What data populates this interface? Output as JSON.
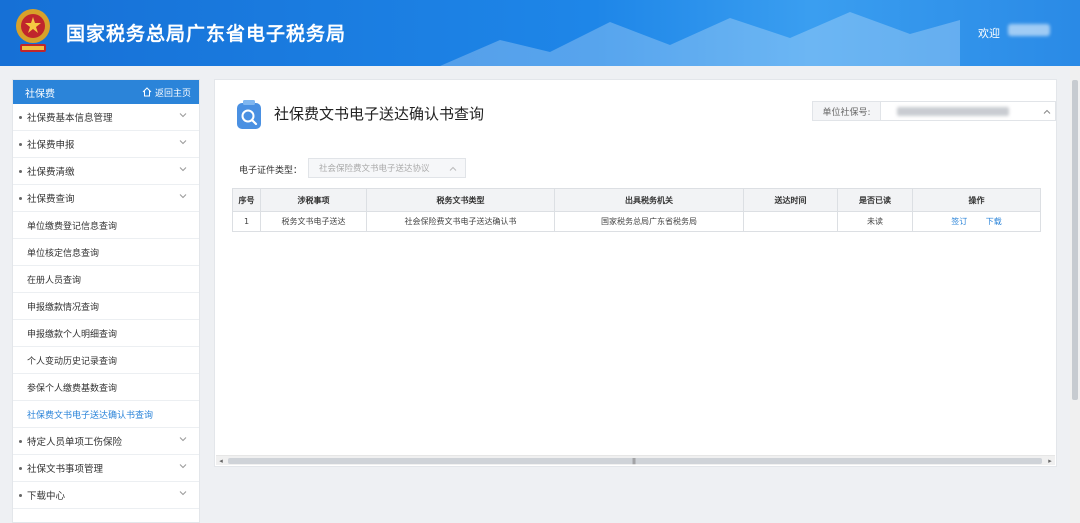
{
  "header": {
    "title": "国家税务总局广东省电子税务局",
    "welcome": "欢迎"
  },
  "sidebar": {
    "title": "社保费",
    "home_link": "返回主页",
    "items": [
      {
        "label": "社保费基本信息管理"
      },
      {
        "label": "社保费申报"
      },
      {
        "label": "社保费清缴"
      },
      {
        "label": "社保费查询"
      }
    ],
    "sub_items": [
      {
        "label": "单位缴费登记信息查询"
      },
      {
        "label": "单位核定信息查询"
      },
      {
        "label": "在册人员查询"
      },
      {
        "label": "申报缴款情况查询"
      },
      {
        "label": "申报缴款个人明细查询"
      },
      {
        "label": "个人变动历史记录查询"
      },
      {
        "label": "参保个人缴费基数查询"
      },
      {
        "label": "社保费文书电子送达确认书查询"
      }
    ],
    "items_after": [
      {
        "label": "特定人员单项工伤保险"
      },
      {
        "label": "社保文书事项管理"
      },
      {
        "label": "下载中心"
      }
    ]
  },
  "main": {
    "page_title": "社保费文书电子送达确认书查询",
    "unit_label": "单位社保号:",
    "filter_label": "电子证件类型：",
    "filter_value": "社会保险费文书电子送达协议",
    "table": {
      "headers": [
        "序号",
        "涉税事项",
        "税务文书类型",
        "出具税务机关",
        "送达时间",
        "是否已读",
        "操作"
      ],
      "rows": [
        [
          "1",
          "税务文书电子送达",
          "社会保险费文书电子送达确认书",
          "国家税务总局广东省税务局",
          "",
          "未读"
        ]
      ],
      "actions": [
        "签订",
        "下载"
      ]
    }
  },
  "colors": {
    "header_blue": "#1e86e8",
    "accent_blue": "#2b84d9"
  },
  "icons": {
    "home": "home-icon",
    "chevron": "chevron-down-icon",
    "page": "document-search-icon"
  }
}
